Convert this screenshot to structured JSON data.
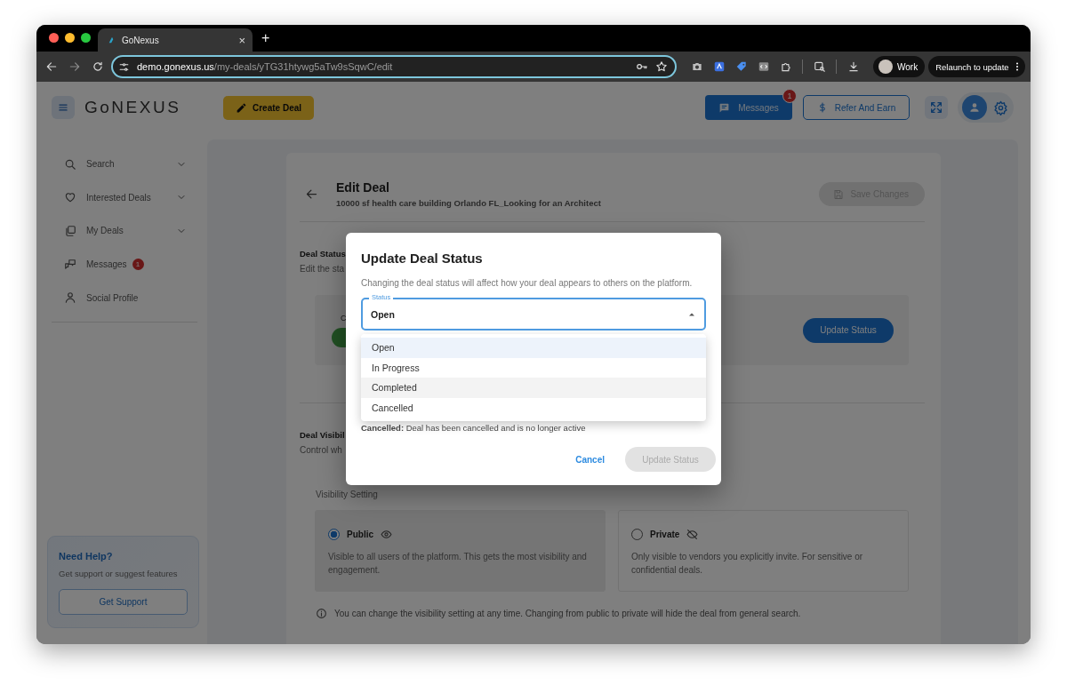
{
  "browser": {
    "tab_title": "GoNexus",
    "new_tab": "+",
    "close_tab": "×",
    "url_host": "demo.gonexus.us",
    "url_path": "/my-deals/yTG31htywg5aTw9sSqwC/edit",
    "profile": "Work",
    "relaunch": "Relaunch to update"
  },
  "header": {
    "logo": "GoNEXUS",
    "create_button": "Create Deal",
    "messages_button": {
      "label": "Messages",
      "badge": "1"
    },
    "refer_button": "Refer And Earn"
  },
  "sidebar": {
    "items": [
      {
        "label": "Search",
        "expandable": true
      },
      {
        "label": "Interested Deals",
        "expandable": true
      },
      {
        "label": "My Deals",
        "expandable": true
      },
      {
        "label": "Messages",
        "expandable": false,
        "badge": "1"
      },
      {
        "label": "Social Profile",
        "expandable": false
      }
    ],
    "help": {
      "title": "Need Help?",
      "text": "Get support or suggest features",
      "button": "Get Support"
    }
  },
  "edit_deal": {
    "title": "Edit Deal",
    "subtitle": "10000 sf health care building Orlando FL_Looking for an Architect",
    "save_button": {
      "label": "Save Changes",
      "disabled": true
    },
    "status_section": {
      "title": "Deal Status",
      "subtitle": "Edit the sta",
      "card_label": "C",
      "update_button": "Update Status"
    },
    "visibility_section": {
      "title": "Deal Visibil",
      "subtitle": "Control wh",
      "setting_label": "Visibility Setting",
      "options": [
        {
          "label": "Public",
          "description": "Visible to all users of the platform. This gets the most visibility and engagement.",
          "selected": true
        },
        {
          "label": "Private",
          "description": "Only visible to vendors you explicitly invite. For sensitive or confidential deals.",
          "selected": false
        }
      ],
      "note": "You can change the visibility setting at any time. Changing from public to private will hide the deal from general search."
    }
  },
  "modal": {
    "title": "Update Deal Status",
    "description": "Changing the deal status will affect how your deal appears to others on the platform.",
    "select": {
      "label": "Status",
      "value": "Open",
      "expanded": true
    },
    "options": [
      {
        "label": "Open",
        "selected": true,
        "hovered": false
      },
      {
        "label": "In Progress",
        "selected": false,
        "hovered": false
      },
      {
        "label": "Completed",
        "selected": false,
        "hovered": true
      },
      {
        "label": "Cancelled",
        "selected": false,
        "hovered": false
      }
    ],
    "status_note": "**Cancelled:** Deal has been cancelled and is no longer active",
    "cancel_button": "Cancel",
    "update_button": {
      "label": "Update Status",
      "disabled": true
    }
  }
}
